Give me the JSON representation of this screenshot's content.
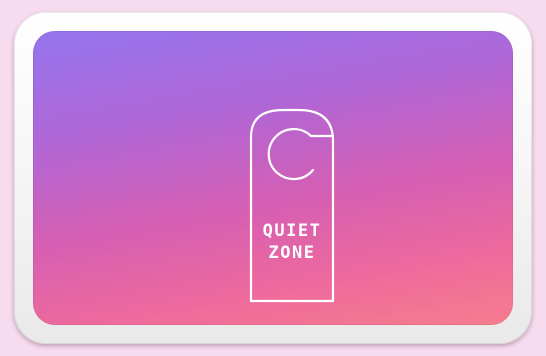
{
  "sign": {
    "line1": "QUIET",
    "line2": "ZONE"
  },
  "icon": "door-hanger-icon",
  "colors": {
    "page_background": "#f7dcef",
    "frame": "#f4f4f4",
    "gradient_top": "#9575ee",
    "gradient_middle": "#d75fb2",
    "gradient_bottom": "#f67d8d",
    "outline": "#ffffff"
  }
}
